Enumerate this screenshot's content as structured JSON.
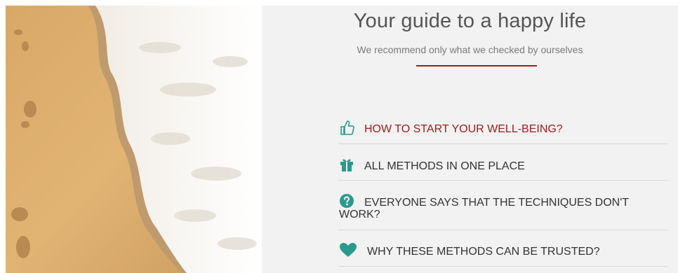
{
  "header": {
    "title": "Your guide to a happy life",
    "subtitle": "We recommend only what we checked by ourselves"
  },
  "menu": {
    "items": [
      {
        "label": "HOW TO START YOUR WELL-BEING?",
        "icon": "thumbs-up-icon",
        "active": true
      },
      {
        "label": "ALL METHODS IN ONE PLACE",
        "icon": "gift-icon",
        "active": false
      },
      {
        "label": "EVERYONE SAYS THAT THE TECHNIQUES DON'T WORK?",
        "icon": "question-circle-icon",
        "active": false
      },
      {
        "label": "WHY THESE METHODS CAN BE TRUSTED?",
        "icon": "heart-icon",
        "active": false
      }
    ]
  },
  "colors": {
    "accent": "#9b1b1b",
    "icon": "#2a9a8f",
    "panel_bg": "#f2f2f2",
    "text": "#333333"
  }
}
